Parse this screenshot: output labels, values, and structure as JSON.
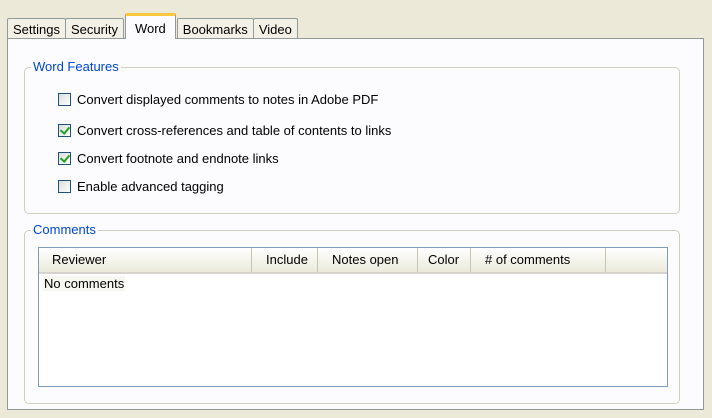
{
  "tabs": [
    {
      "label": "Settings",
      "active": false
    },
    {
      "label": "Security",
      "active": false
    },
    {
      "label": "Word",
      "active": true
    },
    {
      "label": "Bookmarks",
      "active": false
    },
    {
      "label": "Video",
      "active": false
    }
  ],
  "word_features": {
    "legend": "Word Features",
    "options": [
      {
        "label": "Convert displayed comments to notes in Adobe PDF",
        "checked": false
      },
      {
        "label": "Convert cross-references and table of contents to links",
        "checked": true
      },
      {
        "label": "Convert footnote and endnote links",
        "checked": true
      },
      {
        "label": "Enable advanced tagging",
        "checked": false
      }
    ]
  },
  "comments": {
    "legend": "Comments",
    "columns": [
      "Reviewer",
      "Include",
      "Notes open",
      "Color",
      "# of comments"
    ],
    "empty_text": "No comments"
  },
  "colors": {
    "legend_text": "#0046d5",
    "active_tab_accent": "#ffc83c",
    "check_mark": "#21a121"
  }
}
